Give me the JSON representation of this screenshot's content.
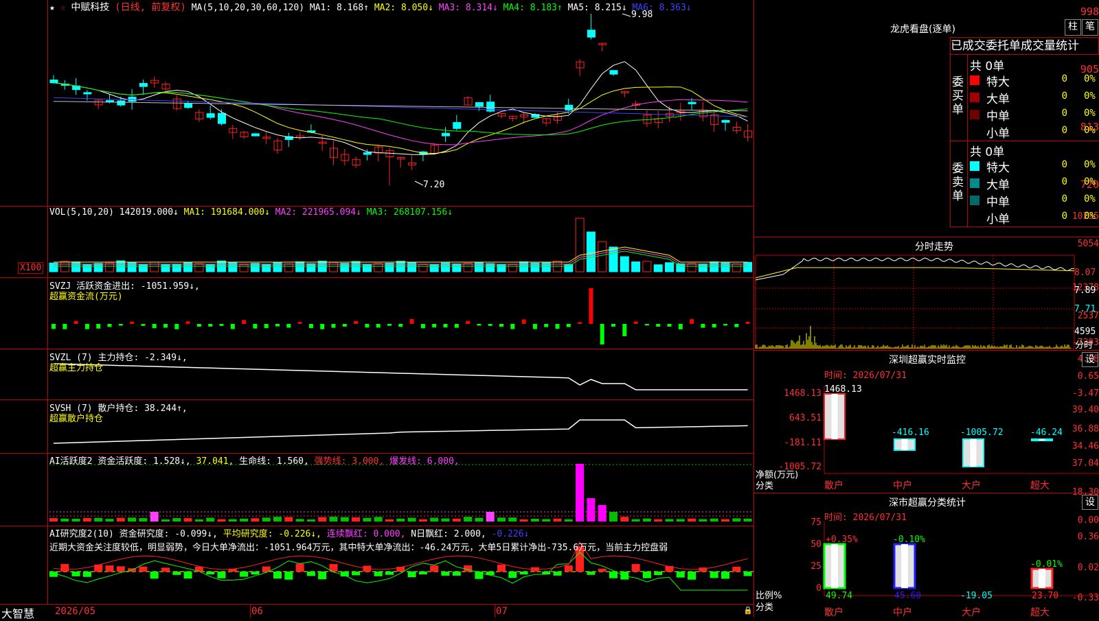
{
  "header": {
    "star": "★",
    "star2": "☆",
    "stock_name": "中赋科技",
    "period": "(日线, 前复权)",
    "ma_title": "MA(5,10,20,30,60,120)",
    "ma1": "MA1: 8.168↑",
    "ma2": "MA2: 8.050↓",
    "ma3": "MA3: 8.314↓",
    "ma4": "MA4: 8.183↑",
    "ma5": "MA5: 8.215↓",
    "ma6": "MA6: 8.363↓"
  },
  "price_axis": [
    "998",
    "905",
    "813",
    "720"
  ],
  "price_annotations": {
    "high": "9.98",
    "low": "7.20"
  },
  "vol": {
    "title": "VOL(5,10,20)",
    "value": "142019.000↓",
    "ma1": "MA1: 191684.000↓",
    "ma2": "MA2: 221965.094↓",
    "ma3": "MA3: 268107.156↓",
    "axis": [
      "10235",
      "5054"
    ],
    "unit": "X100"
  },
  "svzj": {
    "title": "SVZJ",
    "label": "活跃资金进出: -1051.959↓,",
    "sub": "超赢资金流(万元)",
    "axis": [
      "12378",
      "2537",
      "-7303"
    ]
  },
  "svzl": {
    "title": "SVZL (7)",
    "label": "主力持仓: -2.349↓,",
    "sub": "超赢主力持仓",
    "axis": [
      "4.78",
      "0.65",
      "-3.47"
    ]
  },
  "svsh": {
    "title": "SVSH (7)",
    "label": "散户持仓: 38.244↑,",
    "sub": "超赢散户持仓",
    "axis": [
      "39.40",
      "36.88",
      "34.46"
    ]
  },
  "ai1": {
    "title": "AI活跃度2",
    "label1": "资金活跃度: 1.528↓,",
    "label2": "37.041,",
    "label3": "生命线: 1.560,",
    "label4": "强势线: 3.000,",
    "label5": "爆发线: 6.000,",
    "axis": [
      "37.04",
      "18.30",
      "0.00"
    ]
  },
  "ai2": {
    "title": "AI研究度2(10)",
    "label1": "资金研究度: -0.099↓,",
    "label2": "平均研究度: -0.226↓,",
    "label3": "连续飘红: 0.000,",
    "label4": "N日飘红: 2.000,",
    "label5": "-0.226↓",
    "desc": "近期大资金关注度较低，明显弱势，今日大单净流出：-1051.964万元，其中特大单净流出：-46.24万元，大单5日累计净出-735.6万元，当前主力控盘弱",
    "axis": [
      "0.36",
      "0.02",
      "-0.33"
    ]
  },
  "bottom": {
    "brand": "大智慧",
    "dates": [
      "2026/05",
      "06",
      "07"
    ]
  },
  "right_top": {
    "title": "龙虎看盘(逐单)",
    "btn_col": "柱",
    "btn_pen": "笔",
    "tab1": "已成交",
    "tab2": "委托单",
    "tab3": "成交量统计",
    "buy_label": "委买单",
    "sell_label": "委卖单",
    "buy_total": "共 0单",
    "sell_total": "共 0单",
    "buy_rows": [
      {
        "name": "特大",
        "count": "0",
        "pct": "0%",
        "color": "#ff0000"
      },
      {
        "name": "大单",
        "count": "0",
        "pct": "0%",
        "color": "#a00000"
      },
      {
        "name": "中单",
        "count": "0",
        "pct": "0%",
        "color": "#700000"
      },
      {
        "name": "小单",
        "count": "0",
        "pct": "0%",
        "color": "#000000"
      }
    ],
    "sell_rows": [
      {
        "name": "特大",
        "count": "0",
        "pct": "0%",
        "color": "#00ffff"
      },
      {
        "name": "大单",
        "count": "0",
        "pct": "0%",
        "color": "#008c8c"
      },
      {
        "name": "中单",
        "count": "0",
        "pct": "0%",
        "color": "#006a6a"
      },
      {
        "name": "小单",
        "count": "0",
        "pct": "0%",
        "color": "#000000"
      }
    ]
  },
  "intraday": {
    "title": "分时走势",
    "axis": [
      "8.07",
      "7.89",
      "7.71"
    ],
    "vol_label": "4595",
    "unit": "分时"
  },
  "sz_monitor": {
    "title": "深圳超赢实时监控",
    "btn": "设",
    "time": "时间: 2026/07/31",
    "axis": [
      "1468.13",
      "643.51",
      "-181.11",
      "-1005.72"
    ],
    "ylabel": "净额(万元)",
    "xlabel": "分类",
    "values": [
      "1468.13",
      "-416.16",
      "-1005.72",
      "-46.24"
    ],
    "categories": [
      "散户",
      "中户",
      "大户",
      "超大"
    ]
  },
  "sz_class": {
    "title": "深市超赢分类统计",
    "btn": "设",
    "time": "时间: 2026/07/31",
    "axis": [
      "75",
      "50",
      "25",
      "0"
    ],
    "ylabel": "比例%",
    "xlabel": "分类",
    "top_labels": [
      "+0.35%",
      "-0.10%",
      "",
      "-0.01%"
    ],
    "bottom_labels": [
      "49.74",
      "45.60",
      "-19.05",
      "23.70"
    ],
    "categories": [
      "散户",
      "中户",
      "大户",
      "超大"
    ]
  },
  "chart_data": [
    {
      "type": "bar",
      "title": "深圳超赢实时监控",
      "categories": [
        "散户",
        "中户",
        "大户",
        "超大"
      ],
      "values": [
        1468.13,
        -416.16,
        -1005.72,
        -46.24
      ],
      "ylabel": "净额(万元)",
      "ylim": [
        -1005.72,
        1468.13
      ]
    },
    {
      "type": "bar",
      "title": "深市超赢分类统计",
      "categories": [
        "散户",
        "中户",
        "大户",
        "超大"
      ],
      "values": [
        49.74,
        45.6,
        -19.05,
        23.7
      ],
      "ylabel": "比例%",
      "ylim": [
        0,
        75
      ]
    }
  ]
}
